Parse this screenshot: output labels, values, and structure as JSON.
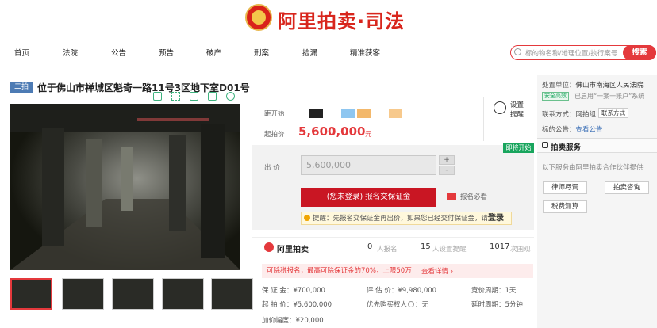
{
  "header": {
    "brand": "阿里拍卖·司法"
  },
  "nav": {
    "items": [
      "首页",
      "法院",
      "公告",
      "预告",
      "破产",
      "刑案",
      "捡漏",
      "精准获客"
    ],
    "search_placeholder": "标的物名称/地理位置/执行案号",
    "search_button": "搜索"
  },
  "lot": {
    "badge": "二拍",
    "title": "位于佛山市禅城区魁奇一路11号3区地下室D01号"
  },
  "price": {
    "countdown_label": "距开始",
    "start_label": "起拍价",
    "start_value": "5,600,000",
    "unit": "元",
    "remind_label": "设置提醒",
    "status_tag": "即将开始",
    "bid_label": "出 价",
    "bid_value": "5,600,000",
    "plus": "+",
    "minus": "-",
    "signup_button": "(您未登录) 报名交保证金",
    "must_read": "报名必看",
    "tip_prefix": "提醒：先报名交保证金再出价，如果您已经交付保证金，请",
    "tip_login": "登录"
  },
  "stats": {
    "brand": "阿里拍卖",
    "signup_count": "0",
    "signup_label": "人报名",
    "remind_count": "15",
    "remind_label": "人设置提醒",
    "view_count": "1017",
    "view_label": "次围观"
  },
  "promo": {
    "text": "可除税报名，最高可除保证金的70%，上限50万",
    "link": "查看详情 ›"
  },
  "info": {
    "deposit": "保 证 金：¥700,000",
    "appraisal": "评 估 价：¥9,980,000",
    "bid_cycle": "竞价周期：1天",
    "start_price": "起 拍 价：¥5,600,000",
    "priority_label": "优先购买权人",
    "priority_value": "：无",
    "delay_cycle": "延时周期：5分钟",
    "increment": "加价幅度：¥20,000"
  },
  "sidebar": {
    "unit_label": "处置单位：",
    "unit_value": "佛山市南海区人民法院",
    "safety_badge": "安全高效",
    "safety_text": "已启用“一案一账户”系统",
    "contact_label": "联系方式：",
    "contact_value": "网拍组",
    "contact_button": "联系方式",
    "notice_label": "标的公告：",
    "notice_link": "查看公告",
    "service_title": "拍卖服务",
    "service_desc": "以下服务由阿里拍卖合作伙伴提供",
    "btn_lawyer": "律师尽调",
    "btn_consult": "拍卖咨询",
    "btn_tax": "税费测算"
  }
}
